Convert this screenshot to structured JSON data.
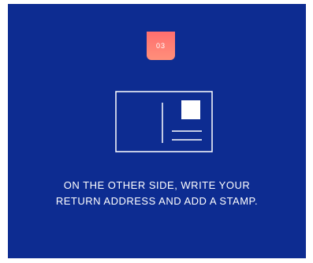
{
  "step": {
    "number": "03"
  },
  "instruction": {
    "line1": "ON THE OTHER SIDE, WRITE YOUR",
    "line2": "RETURN ADDRESS AND ADD A STAMP."
  },
  "colors": {
    "background": "#0d2c91",
    "badge": "#ff7777",
    "text": "#ffffff"
  },
  "icons": {
    "postcard": "postcard-icon"
  }
}
